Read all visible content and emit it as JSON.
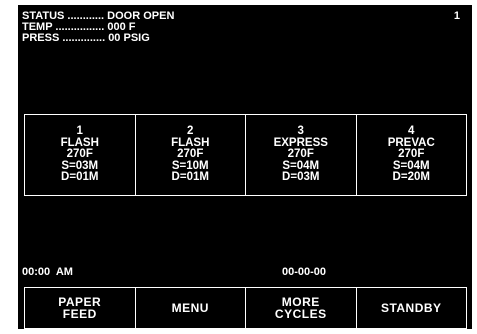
{
  "status": {
    "lines": [
      "STATUS ............ DOOR OPEN",
      "TEMP ................ 000 F",
      "PRESS .............. 00 PSIG"
    ],
    "page_number": "1"
  },
  "cycles": [
    {
      "number": "1",
      "name": "FLASH",
      "temp": "270F",
      "sterilize": "S=03M",
      "dry": "D=01M"
    },
    {
      "number": "2",
      "name": "FLASH",
      "temp": "270F",
      "sterilize": "S=10M",
      "dry": "D=01M"
    },
    {
      "number": "3",
      "name": "EXPRESS",
      "temp": "270F",
      "sterilize": "S=04M",
      "dry": "D=03M"
    },
    {
      "number": "4",
      "name": "PREVAC",
      "temp": "270F",
      "sterilize": "S=04M",
      "dry": "D=20M"
    }
  ],
  "footer": {
    "time": "00:00  AM",
    "date": "00-00-00"
  },
  "softkeys": [
    {
      "label": "PAPER\nFEED"
    },
    {
      "label": "MENU"
    },
    {
      "label": "MORE\nCYCLES"
    },
    {
      "label": "STANDBY"
    }
  ]
}
